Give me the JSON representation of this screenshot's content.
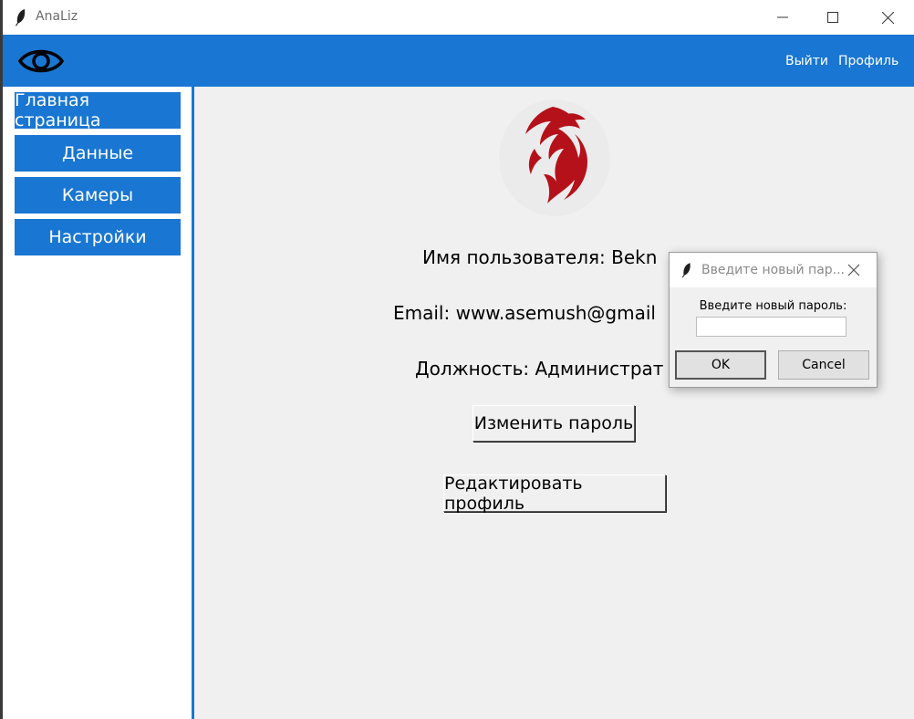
{
  "window": {
    "title": "AnaLiz"
  },
  "topbar": {
    "logout_label": "Выйти",
    "profile_label": "Профиль"
  },
  "sidebar": {
    "items": [
      {
        "label": "Главная страница"
      },
      {
        "label": "Данные"
      },
      {
        "label": "Камеры"
      },
      {
        "label": "Настройки"
      }
    ]
  },
  "profile": {
    "username_line": "Имя пользователя: Bekn",
    "email_line": "Email: www.asemush@gmail",
    "role_line": "Должность: Администрат",
    "change_password_label": "Изменить пароль",
    "edit_profile_label": "Редактировать профиль"
  },
  "dialog": {
    "title": "Введите новый пар...",
    "prompt": "Введите новый пароль:",
    "input_value": "",
    "ok_label": "OK",
    "cancel_label": "Cancel"
  },
  "colors": {
    "accent": "#1976d2",
    "logo_red": "#b5111a"
  },
  "icons": {
    "app": "feather-icon",
    "eye": "eye-icon",
    "logo": "phoenix-logo"
  }
}
